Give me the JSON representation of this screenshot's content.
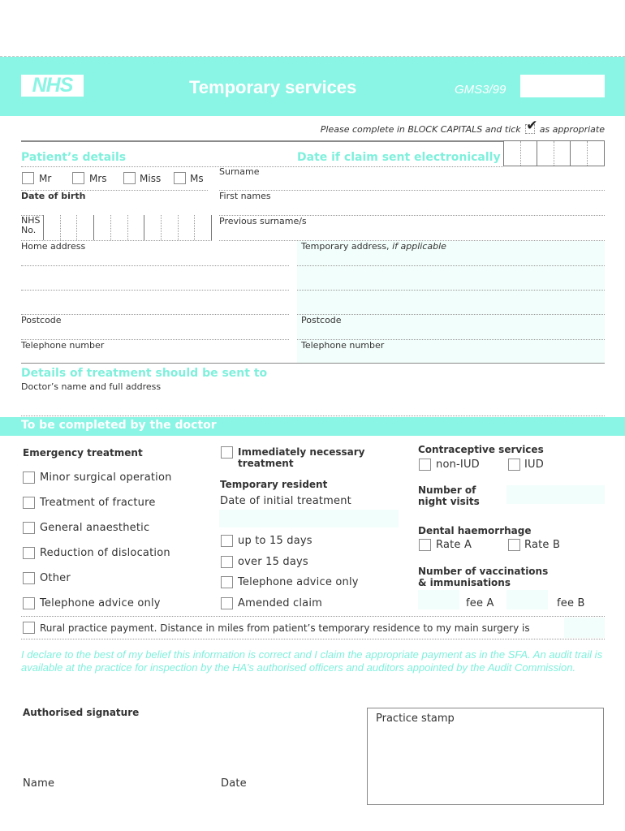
{
  "header": {
    "logo": "NHS",
    "title": "Temporary services",
    "form_code": "GMS3/99",
    "form_box_value": ""
  },
  "instructions": {
    "text_before": "Please complete in BLOCK CAPITALS and tick",
    "tick_glyph": "✔",
    "text_after": "as appropriate"
  },
  "patient": {
    "section_title": "Patient’s details",
    "electronic_date_label": "Date if claim sent electronically",
    "titles": [
      "Mr",
      "Mrs",
      "Miss",
      "Ms"
    ],
    "date_of_birth": "Date of birth",
    "nhs_no": "NHS No.",
    "surname": "Surname",
    "first_names": "First names",
    "previous_surnames": "Previous surname/s",
    "home_address": "Home address",
    "temp_address": "Temporary address,",
    "temp_address_italic": "if applicable",
    "postcode_home": "Postcode",
    "postcode_temp": "Postcode",
    "phone_home": "Telephone number",
    "phone_temp": "Telephone number"
  },
  "treatment_dest": {
    "section_title": "Details of treatment should be sent to",
    "doctor_label": "Doctor’s name and full address"
  },
  "doctor": {
    "section_title": "To be completed by the doctor",
    "emergency": {
      "title": "Emergency treatment",
      "items": [
        "Minor surgical operation",
        "Treatment of fracture",
        "General anaesthetic",
        "Reduction of dislocation",
        "Other",
        "Telephone advice only"
      ]
    },
    "immediately_necessary": "Immediately necessary treatment",
    "immediately_line1": "Immediately necessary",
    "immediately_line2": "treatment",
    "temp_resident": {
      "title": "Temporary resident",
      "date_label": "Date of initial treatment",
      "items": [
        "up to 15 days",
        "over 15 days",
        "Telephone advice only",
        "Amended claim"
      ]
    },
    "contraceptive": {
      "title": "Contraceptive services",
      "options": [
        "non-IUD",
        "IUD"
      ]
    },
    "night_visits_line1": "Number of",
    "night_visits_line2": "night visits",
    "dental": {
      "title": "Dental haemorrhage",
      "options": [
        "Rate A",
        "Rate B"
      ]
    },
    "vaccinations_line1": "Number of vaccinations",
    "vaccinations_line2": "& immunisations",
    "fee_a": "fee A",
    "fee_b": "fee B",
    "rural": "Rural practice payment. Distance in miles from patient’s temporary residence to my main surgery is"
  },
  "declaration": "I declare to the best of my belief this information is correct and I claim the appropriate payment as in the SFA. An audit trail is available at the practice for inspection by the HA’s authorised officers and auditors appointed by the Audit Commission.",
  "signature": {
    "authorised": "Authorised signature",
    "name": "Name",
    "date": "Date",
    "stamp": "Practice stamp"
  }
}
